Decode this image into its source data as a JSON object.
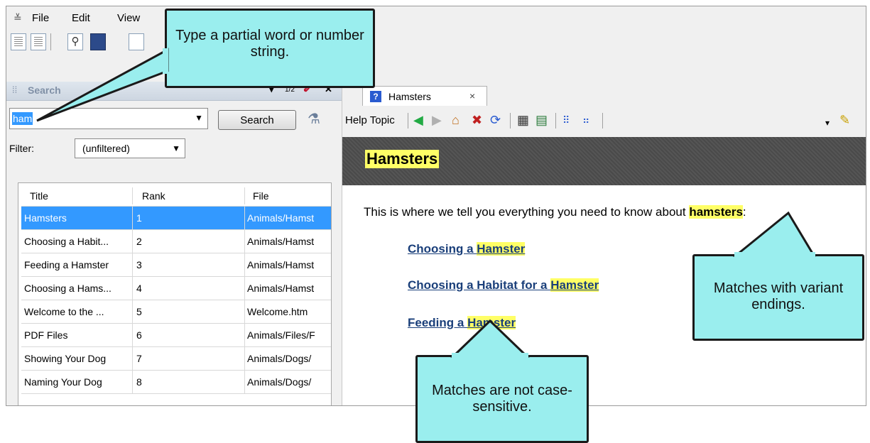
{
  "menu": {
    "items": [
      "File",
      "Edit",
      "View"
    ]
  },
  "search_pane": {
    "title": "Search",
    "header_buttons": {
      "dropdown": "▾",
      "pin": "✕"
    },
    "query": "ham",
    "search_button": "Search",
    "filter_label": "Filter:",
    "filter_value": "(unfiltered)"
  },
  "results": {
    "columns": [
      "Title",
      "Rank",
      "File"
    ],
    "rows": [
      {
        "title": "Hamsters",
        "rank": "1",
        "file": "Animals/Hamst"
      },
      {
        "title": "Choosing a Habit...",
        "rank": "2",
        "file": "Animals/Hamst"
      },
      {
        "title": "Feeding a Hamster",
        "rank": "3",
        "file": "Animals/Hamst"
      },
      {
        "title": "Choosing a Hams...",
        "rank": "4",
        "file": "Animals/Hamst"
      },
      {
        "title": "Welcome to the ...",
        "rank": "5",
        "file": "Welcome.htm"
      },
      {
        "title": "PDF Files",
        "rank": "6",
        "file": "Animals/Files/F"
      },
      {
        "title": "Showing Your Dog",
        "rank": "7",
        "file": "Animals/Dogs/"
      },
      {
        "title": "Naming Your Dog",
        "rank": "8",
        "file": "Animals/Dogs/"
      }
    ]
  },
  "viewer": {
    "tab_label": "Hamsters",
    "tab_close": "×",
    "toolbar_label": "Help Topic",
    "topic_title": "Hamsters",
    "intro_prefix": "This is where we tell you everything you need to know about ",
    "intro_highlight": "hamsters",
    "intro_suffix": ":",
    "links": [
      {
        "prefix": "Choosing a ",
        "highlight": "Hamster"
      },
      {
        "prefix": "Choosing a Habitat for a ",
        "highlight": "Hamster"
      },
      {
        "prefix": "Feeding a ",
        "highlight": "Hamster"
      }
    ]
  },
  "callouts": {
    "partial": "Type a partial word or number string.",
    "variant": "Matches with variant endings.",
    "case": "Matches are not case-sensitive."
  },
  "colors": {
    "callout_fill": "#9aeeee",
    "highlight": "#ffff66",
    "selection": "#3399ff",
    "link": "#1a3f7a"
  }
}
